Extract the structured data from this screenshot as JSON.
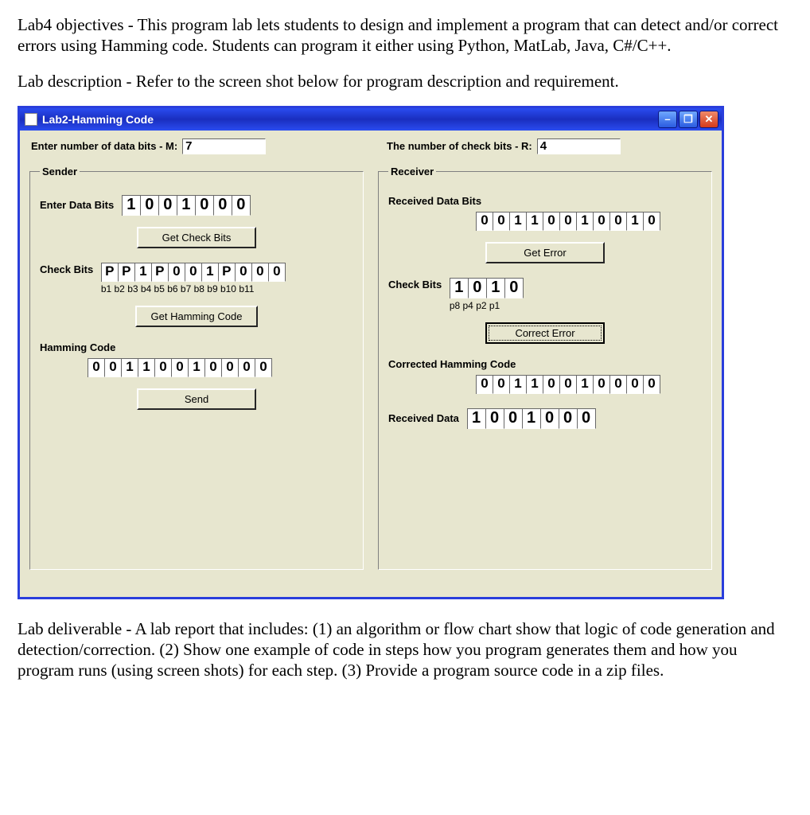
{
  "doc": {
    "objectives": "Lab4 objectives - This program lab lets students to design and implement a program that can detect and/or correct errors using Hamming code.  Students can program it either using Python, MatLab, Java, C#/C++.",
    "description": "Lab description - Refer to the screen shot below for program description and requirement.",
    "deliverable": "Lab deliverable - A lab report that includes: (1) an algorithm or flow chart show that logic of code generation and detection/correction.  (2) Show one example of code in steps how you program generates them and how you program runs (using screen shots) for each step. (3) Provide a program source code in a zip files."
  },
  "window": {
    "title": "Lab2-Hamming Code"
  },
  "top": {
    "m_label": "Enter number of data bits - M:",
    "m_value": "7",
    "r_label": "The number of check bits - R:",
    "r_value": "4"
  },
  "sender": {
    "legend": "Sender",
    "enter_label": "Enter Data Bits",
    "data_bits": [
      "1",
      "0",
      "0",
      "1",
      "0",
      "0",
      "0"
    ],
    "btn_get_check": "Get Check Bits",
    "check_label": "Check Bits",
    "check_bits": [
      "P",
      "P",
      "1",
      "P",
      "0",
      "0",
      "1",
      "P",
      "0",
      "0",
      "0"
    ],
    "check_bit_labels": "b1 b2 b3 b4 b5 b6 b7 b8 b9 b10 b11",
    "btn_get_hamming": "Get Hamming Code",
    "hamming_label": "Hamming Code",
    "hamming_bits": [
      "0",
      "0",
      "1",
      "1",
      "0",
      "0",
      "1",
      "0",
      "0",
      "0",
      "0"
    ],
    "btn_send": "Send"
  },
  "receiver": {
    "legend": "Receiver",
    "received_label": "Received Data Bits",
    "received_bits": [
      "0",
      "0",
      "1",
      "1",
      "0",
      "0",
      "1",
      "0",
      "0",
      "1",
      "0"
    ],
    "btn_get_error": "Get Error",
    "check_label": "Check Bits",
    "check_bits": [
      "1",
      "0",
      "1",
      "0"
    ],
    "check_bit_labels": "p8 p4 p2 p1",
    "btn_correct": "Correct Error",
    "corrected_label": "Corrected Hamming Code",
    "corrected_bits": [
      "0",
      "0",
      "1",
      "1",
      "0",
      "0",
      "1",
      "0",
      "0",
      "0",
      "0"
    ],
    "received_data_label": "Received Data",
    "received_data": [
      "1",
      "0",
      "0",
      "1",
      "0",
      "0",
      "0"
    ]
  }
}
